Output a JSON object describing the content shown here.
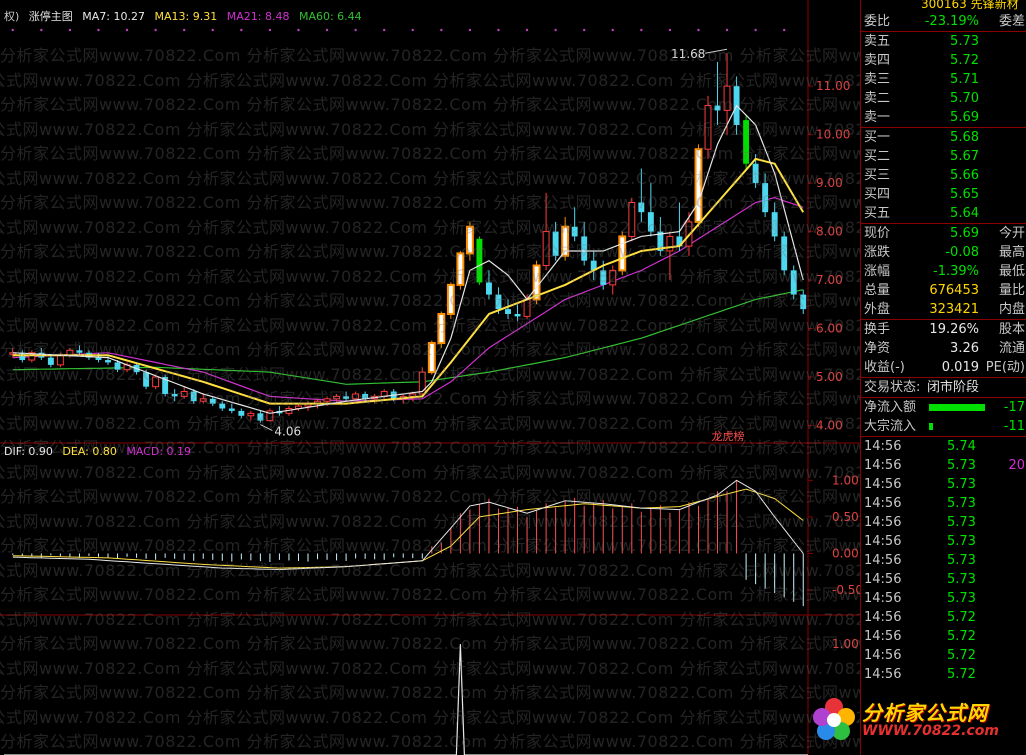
{
  "main_header": {
    "left_label": "权)",
    "title": "涨停主图",
    "ma7": "MA7: 10.27",
    "ma13": "MA13: 9.31",
    "ma21": "MA21: 8.48",
    "ma60": "MA60: 6.44"
  },
  "macd_header": {
    "dif": "DIF: 0.90",
    "dea": "DEA: 0.80",
    "macd": "MACD: 0.19"
  },
  "colors": {
    "up": "#ff3a3a",
    "down": "#4ed8f0",
    "ma7": "#e8e8e8",
    "ma13": "#ffe040",
    "ma21": "#d030d0",
    "ma60": "#30c030",
    "zt_bar": "#ff9000",
    "dt_bar": "#00e000",
    "grid": "#8b0000"
  },
  "annotations": {
    "high": "11.68",
    "low": "4.06",
    "lhb": "龙虎榜"
  },
  "watermark": "分析家公式网www.70822.Com",
  "price_axis": [
    "11.00",
    "10.00",
    "9.00",
    "8.00",
    "7.00",
    "6.00",
    "5.00",
    "4.00"
  ],
  "macd_axis": [
    "1.00",
    "0.50",
    "0.00",
    "-0.50"
  ],
  "ind_axis": [
    "1.00"
  ],
  "chart_data": {
    "type": "candlestick",
    "ylim": [
      3.7,
      12.2
    ],
    "candles": [
      [
        5.5,
        5.6,
        5.4,
        5.5
      ],
      [
        5.5,
        5.55,
        5.3,
        5.35
      ],
      [
        5.35,
        5.55,
        5.3,
        5.5
      ],
      [
        5.5,
        5.6,
        5.35,
        5.4
      ],
      [
        5.4,
        5.45,
        5.2,
        5.25
      ],
      [
        5.25,
        5.5,
        5.2,
        5.45
      ],
      [
        5.45,
        5.6,
        5.4,
        5.55
      ],
      [
        5.55,
        5.65,
        5.45,
        5.5
      ],
      [
        5.5,
        5.55,
        5.35,
        5.4
      ],
      [
        5.4,
        5.5,
        5.3,
        5.35
      ],
      [
        5.35,
        5.45,
        5.25,
        5.3
      ],
      [
        5.3,
        5.35,
        5.1,
        5.15
      ],
      [
        5.15,
        5.3,
        5.1,
        5.25
      ],
      [
        5.25,
        5.3,
        5.05,
        5.1
      ],
      [
        5.1,
        5.15,
        4.75,
        4.8
      ],
      [
        4.8,
        5.05,
        4.75,
        5.0
      ],
      [
        5.0,
        5.05,
        4.6,
        4.65
      ],
      [
        4.65,
        4.75,
        4.5,
        4.6
      ],
      [
        4.6,
        4.8,
        4.55,
        4.7
      ],
      [
        4.7,
        4.75,
        4.45,
        4.5
      ],
      [
        4.5,
        4.65,
        4.45,
        4.55
      ],
      [
        4.55,
        4.6,
        4.4,
        4.45
      ],
      [
        4.45,
        4.5,
        4.3,
        4.35
      ],
      [
        4.35,
        4.45,
        4.25,
        4.3
      ],
      [
        4.3,
        4.35,
        4.15,
        4.2
      ],
      [
        4.2,
        4.3,
        4.1,
        4.25
      ],
      [
        4.25,
        4.3,
        4.06,
        4.1
      ],
      [
        4.1,
        4.35,
        4.08,
        4.3
      ],
      [
        4.3,
        4.4,
        4.2,
        4.25
      ],
      [
        4.25,
        4.4,
        4.2,
        4.35
      ],
      [
        4.35,
        4.45,
        4.3,
        4.4
      ],
      [
        4.4,
        4.5,
        4.3,
        4.45
      ],
      [
        4.45,
        4.55,
        4.35,
        4.5
      ],
      [
        4.5,
        4.6,
        4.4,
        4.55
      ],
      [
        4.55,
        4.65,
        4.45,
        4.6
      ],
      [
        4.6,
        4.7,
        4.5,
        4.55
      ],
      [
        4.55,
        4.7,
        4.5,
        4.65
      ],
      [
        4.65,
        4.7,
        4.5,
        4.55
      ],
      [
        4.55,
        4.65,
        4.45,
        4.6
      ],
      [
        4.6,
        4.75,
        4.55,
        4.7
      ],
      [
        4.7,
        4.75,
        4.5,
        4.55
      ],
      [
        4.55,
        4.65,
        4.45,
        4.6
      ],
      [
        4.6,
        4.7,
        4.5,
        4.65
      ],
      [
        4.65,
        5.2,
        4.6,
        5.1
      ],
      [
        5.1,
        5.75,
        5.05,
        5.7
      ],
      [
        5.7,
        6.35,
        5.6,
        6.3
      ],
      [
        6.3,
        6.95,
        6.2,
        6.9
      ],
      [
        6.9,
        7.6,
        6.8,
        7.55
      ],
      [
        7.55,
        8.2,
        7.4,
        8.1
      ],
      [
        7.85,
        7.9,
        6.9,
        6.95
      ],
      [
        6.95,
        7.2,
        6.6,
        6.7
      ],
      [
        6.7,
        6.85,
        6.3,
        6.4
      ],
      [
        6.4,
        6.6,
        6.2,
        6.3
      ],
      [
        6.3,
        6.5,
        6.15,
        6.25
      ],
      [
        6.25,
        6.7,
        6.2,
        6.6
      ],
      [
        6.6,
        7.4,
        6.5,
        7.3
      ],
      [
        7.3,
        8.8,
        7.2,
        8.0
      ],
      [
        8.0,
        8.2,
        7.4,
        7.5
      ],
      [
        7.5,
        8.3,
        7.4,
        8.1
      ],
      [
        8.1,
        8.5,
        7.8,
        7.9
      ],
      [
        7.9,
        8.2,
        7.3,
        7.4
      ],
      [
        7.4,
        7.6,
        7.0,
        7.2
      ],
      [
        7.2,
        7.4,
        6.8,
        6.9
      ],
      [
        6.9,
        7.3,
        6.7,
        7.2
      ],
      [
        7.2,
        8.0,
        7.1,
        7.9
      ],
      [
        7.9,
        8.7,
        7.8,
        8.6
      ],
      [
        8.6,
        9.3,
        8.2,
        8.4
      ],
      [
        8.4,
        9.0,
        7.9,
        8.0
      ],
      [
        8.0,
        8.3,
        7.5,
        7.6
      ],
      [
        7.6,
        8.0,
        7.0,
        7.9
      ],
      [
        7.9,
        8.6,
        7.6,
        7.7
      ],
      [
        7.7,
        8.4,
        7.5,
        8.2
      ],
      [
        8.2,
        9.8,
        8.1,
        9.7
      ],
      [
        9.7,
        10.8,
        9.5,
        10.6
      ],
      [
        10.6,
        11.5,
        10.2,
        10.5
      ],
      [
        10.5,
        11.68,
        10.0,
        11.0
      ],
      [
        11.0,
        11.2,
        10.0,
        10.2
      ],
      [
        10.3,
        10.4,
        9.3,
        9.4
      ],
      [
        9.4,
        9.6,
        8.9,
        9.0
      ],
      [
        9.0,
        9.2,
        8.3,
        8.4
      ],
      [
        8.4,
        8.6,
        7.8,
        7.9
      ],
      [
        7.9,
        8.0,
        7.1,
        7.2
      ],
      [
        7.2,
        7.3,
        6.6,
        6.7
      ],
      [
        6.7,
        6.8,
        6.3,
        6.4
      ]
    ],
    "zt_index": [
      44,
      45,
      46,
      47,
      48,
      55,
      58,
      64,
      72
    ],
    "dt_index": [
      49,
      77
    ],
    "ma7_anchor": [
      [
        0,
        5.5
      ],
      [
        10,
        5.4
      ],
      [
        20,
        4.65
      ],
      [
        27,
        4.25
      ],
      [
        35,
        4.5
      ],
      [
        43,
        4.7
      ],
      [
        44,
        4.9
      ],
      [
        46,
        5.8
      ],
      [
        48,
        7.2
      ],
      [
        50,
        7.4
      ],
      [
        52,
        7.1
      ],
      [
        54,
        6.6
      ],
      [
        56,
        7.1
      ],
      [
        58,
        7.6
      ],
      [
        62,
        7.6
      ],
      [
        66,
        7.9
      ],
      [
        70,
        8.0
      ],
      [
        72,
        8.6
      ],
      [
        74,
        9.8
      ],
      [
        76,
        10.6
      ],
      [
        78,
        10.2
      ],
      [
        80,
        9.2
      ],
      [
        83,
        7.0
      ]
    ],
    "ma13_anchor": [
      [
        0,
        5.45
      ],
      [
        10,
        5.45
      ],
      [
        20,
        4.9
      ],
      [
        27,
        4.45
      ],
      [
        35,
        4.45
      ],
      [
        43,
        4.6
      ],
      [
        46,
        5.3
      ],
      [
        48,
        5.8
      ],
      [
        50,
        6.3
      ],
      [
        54,
        6.6
      ],
      [
        58,
        6.9
      ],
      [
        62,
        7.3
      ],
      [
        66,
        7.6
      ],
      [
        70,
        7.7
      ],
      [
        74,
        8.6
      ],
      [
        78,
        9.5
      ],
      [
        80,
        9.4
      ],
      [
        83,
        8.4
      ]
    ],
    "ma21_anchor": [
      [
        0,
        5.4
      ],
      [
        10,
        5.5
      ],
      [
        20,
        5.1
      ],
      [
        27,
        4.6
      ],
      [
        35,
        4.5
      ],
      [
        43,
        4.55
      ],
      [
        46,
        4.9
      ],
      [
        50,
        5.6
      ],
      [
        54,
        6.1
      ],
      [
        58,
        6.6
      ],
      [
        62,
        6.9
      ],
      [
        66,
        7.2
      ],
      [
        70,
        7.6
      ],
      [
        74,
        8.1
      ],
      [
        78,
        8.6
      ],
      [
        80,
        8.7
      ],
      [
        83,
        8.5
      ]
    ],
    "ma60_anchor": [
      [
        0,
        5.15
      ],
      [
        15,
        5.2
      ],
      [
        27,
        5.1
      ],
      [
        35,
        4.85
      ],
      [
        43,
        4.9
      ],
      [
        50,
        5.1
      ],
      [
        58,
        5.4
      ],
      [
        66,
        5.8
      ],
      [
        72,
        6.2
      ],
      [
        78,
        6.6
      ],
      [
        83,
        6.8
      ]
    ],
    "macd_ylim": [
      -0.8,
      1.25
    ],
    "dif_anchor": [
      [
        0,
        -0.05
      ],
      [
        8,
        -0.08
      ],
      [
        15,
        -0.14
      ],
      [
        22,
        -0.2
      ],
      [
        28,
        -0.22
      ],
      [
        35,
        -0.18
      ],
      [
        43,
        -0.1
      ],
      [
        46,
        0.35
      ],
      [
        48,
        0.65
      ],
      [
        50,
        0.7
      ],
      [
        54,
        0.55
      ],
      [
        58,
        0.72
      ],
      [
        62,
        0.68
      ],
      [
        66,
        0.62
      ],
      [
        70,
        0.6
      ],
      [
        74,
        0.8
      ],
      [
        76,
        1.0
      ],
      [
        78,
        0.85
      ],
      [
        80,
        0.5
      ],
      [
        83,
        0.0
      ]
    ],
    "dea_anchor": [
      [
        0,
        -0.03
      ],
      [
        10,
        -0.06
      ],
      [
        20,
        -0.15
      ],
      [
        28,
        -0.2
      ],
      [
        35,
        -0.18
      ],
      [
        43,
        -0.1
      ],
      [
        46,
        0.1
      ],
      [
        49,
        0.5
      ],
      [
        54,
        0.6
      ],
      [
        60,
        0.68
      ],
      [
        66,
        0.62
      ],
      [
        70,
        0.64
      ],
      [
        74,
        0.78
      ],
      [
        77,
        0.88
      ],
      [
        80,
        0.75
      ],
      [
        83,
        0.45
      ]
    ],
    "ind_spike_index": 47,
    "ind_ylim": [
      0,
      1.2
    ]
  },
  "sidebar": {
    "top_text": "300163 先锋新材",
    "weibi": {
      "label": "委比",
      "value": "-23.19%",
      "label2": "委差"
    },
    "sell": [
      {
        "label": "卖五",
        "price": "5.73"
      },
      {
        "label": "卖四",
        "price": "5.72"
      },
      {
        "label": "卖三",
        "price": "5.71"
      },
      {
        "label": "卖二",
        "price": "5.70"
      },
      {
        "label": "卖一",
        "price": "5.69"
      }
    ],
    "buy": [
      {
        "label": "买一",
        "price": "5.68"
      },
      {
        "label": "买二",
        "price": "5.67"
      },
      {
        "label": "买三",
        "price": "5.66"
      },
      {
        "label": "买四",
        "price": "5.65"
      },
      {
        "label": "买五",
        "price": "5.64"
      }
    ],
    "quote": [
      {
        "label": "现价",
        "value": "5.69",
        "label2": "今开",
        "cls": "green"
      },
      {
        "label": "涨跌",
        "value": "-0.08",
        "label2": "最高",
        "cls": "green"
      },
      {
        "label": "涨幅",
        "value": "-1.39%",
        "label2": "最低",
        "cls": "green"
      },
      {
        "label": "总量",
        "value": "676453",
        "label2": "量比",
        "cls": "yellow"
      },
      {
        "label": "外盘",
        "value": "323421",
        "label2": "内盘",
        "cls": "yellow"
      }
    ],
    "stats": [
      {
        "label": "换手",
        "value": "19.26%",
        "label2": "股本"
      },
      {
        "label": "净资",
        "value": "3.26",
        "label2": "流通"
      },
      {
        "label": "收益(-)",
        "value": "0.019",
        "label2": "PE(动)"
      }
    ],
    "status": {
      "label": "交易状态:",
      "value": "闭市阶段"
    },
    "flow": [
      {
        "label": "净流入额",
        "value": "-17"
      },
      {
        "label": "大宗流入",
        "value": "-11"
      }
    ],
    "ticks": [
      {
        "time": "14:56",
        "price": "5.74",
        "vol": ""
      },
      {
        "time": "14:56",
        "price": "5.73",
        "vol": "20"
      },
      {
        "time": "14:56",
        "price": "5.73",
        "vol": ""
      },
      {
        "time": "14:56",
        "price": "5.73",
        "vol": ""
      },
      {
        "time": "14:56",
        "price": "5.73",
        "vol": ""
      },
      {
        "time": "14:56",
        "price": "5.73",
        "vol": ""
      },
      {
        "time": "14:56",
        "price": "5.73",
        "vol": ""
      },
      {
        "time": "14:56",
        "price": "5.73",
        "vol": ""
      },
      {
        "time": "14:56",
        "price": "5.73",
        "vol": ""
      },
      {
        "time": "14:56",
        "price": "5.72",
        "vol": ""
      },
      {
        "time": "14:56",
        "price": "5.72",
        "vol": ""
      },
      {
        "time": "14:56",
        "price": "5.72",
        "vol": ""
      },
      {
        "time": "14:56",
        "price": "5.72",
        "vol": ""
      }
    ]
  },
  "logo": {
    "title": "分析家公式网",
    "url": "WWW.70822.com"
  }
}
